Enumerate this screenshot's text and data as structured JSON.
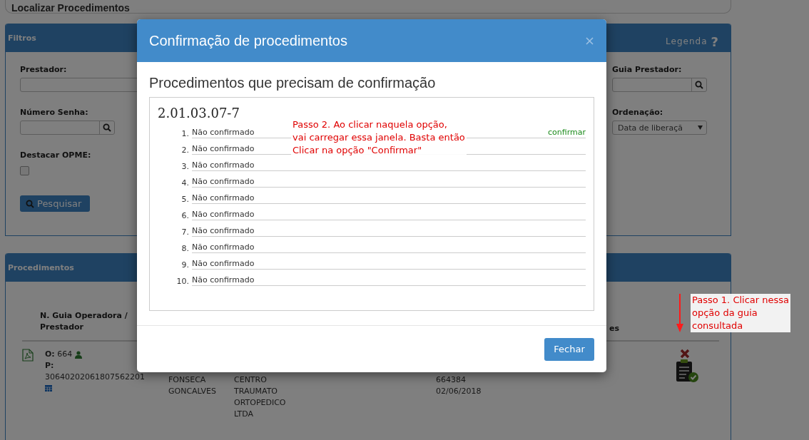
{
  "page_title": "Localizar Procedimentos",
  "filters": {
    "title": "Filtros",
    "legend": "Legenda",
    "legend_icon": "?",
    "left_fields": [
      {
        "label": "Prestador:",
        "kind": "text"
      },
      {
        "label": "Número Senha:",
        "kind": "search"
      },
      {
        "label": "Destacar OPME:",
        "kind": "checkbox",
        "checked": false
      }
    ],
    "search_button": "Pesquisar",
    "right_fields": [
      {
        "label": "Guia Prestador:",
        "kind": "search"
      },
      {
        "label": "Ordenação:",
        "kind": "select",
        "value": "Data de liberaçã"
      }
    ]
  },
  "procedures": {
    "title": "Procedimentos",
    "column_1": "N. Guia Operadora / Prestador",
    "column_5": "es",
    "row": {
      "o_label": "O:",
      "o_value": "664",
      "p_label": "P:",
      "p_value": "30640202061807562201",
      "column_2": [
        "FONSECA",
        "GONCALVES"
      ],
      "column_3": [
        "CENTRO",
        "TRAUMATO",
        "ORTOPEDICO",
        "LTDA"
      ],
      "column_4": [
        "664384",
        "02/06/2018"
      ]
    }
  },
  "annotations": [
    {
      "kind": "step1",
      "lines": [
        "Passo 1. Clicar nessa",
        "opção da guia",
        "consultada"
      ]
    },
    {
      "kind": "step2",
      "lines": [
        "Passo 2. Ao clicar naquela opção,",
        "vai carregar essa janela. Basta então",
        "Clicar na opção \"Confirmar\""
      ]
    }
  ],
  "modal": {
    "title": "Confirmação de procedimentos",
    "heading": "Procedimentos que precisam de confirmação",
    "procedure_code": "2.01.03.07-7",
    "items": [
      {
        "number": "1.",
        "status": "Não confirmado",
        "action": "confirmar"
      },
      {
        "number": "2.",
        "status": "Não confirmado"
      },
      {
        "number": "3.",
        "status": "Não confirmado"
      },
      {
        "number": "4.",
        "status": "Não confirmado"
      },
      {
        "number": "5.",
        "status": "Não confirmado"
      },
      {
        "number": "6.",
        "status": "Não confirmado"
      },
      {
        "number": "7.",
        "status": "Não confirmado"
      },
      {
        "number": "8.",
        "status": "Não confirmado"
      },
      {
        "number": "9.",
        "status": "Não confirmado"
      },
      {
        "number": "10.",
        "status": "Não confirmado"
      }
    ],
    "close_button": "Fechar"
  }
}
